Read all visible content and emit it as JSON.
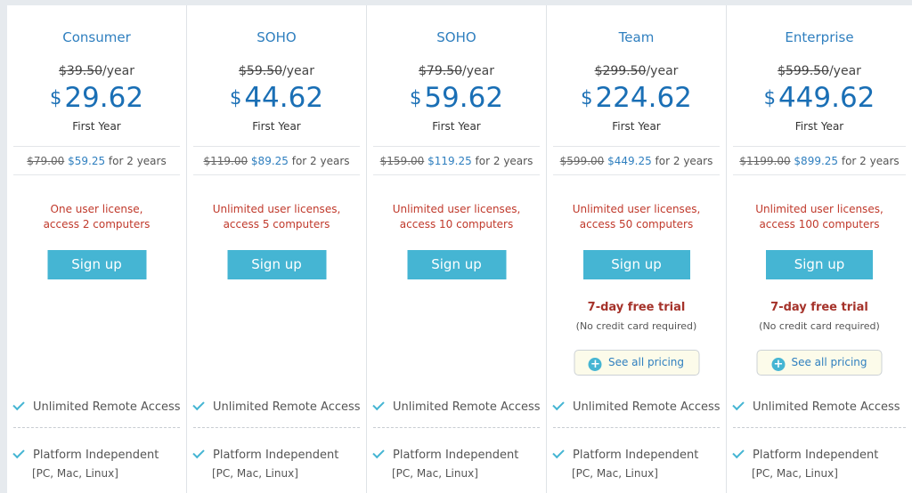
{
  "plans": [
    {
      "name": "Consumer",
      "old_price": "$39.50",
      "per_year": "/year",
      "currency": "$",
      "price": "29.62",
      "first_year": "First Year",
      "two_year_old": "$79.00",
      "two_year_new": "$59.25",
      "two_year_suffix": " for 2 years",
      "license_line1": "One user license,",
      "license_line2": "access 2 computers",
      "signup": "Sign up",
      "feature1": "Unlimited Remote Access",
      "feature2": "Platform Independent",
      "feature2_sub": "[PC, Mac, Linux]"
    },
    {
      "name": "SOHO",
      "old_price": "$59.50",
      "per_year": "/year",
      "currency": "$",
      "price": "44.62",
      "first_year": "First Year",
      "two_year_old": "$119.00",
      "two_year_new": "$89.25",
      "two_year_suffix": " for 2 years",
      "license_line1": "Unlimited user licenses,",
      "license_line2": "access 5 computers",
      "signup": "Sign up",
      "feature1": "Unlimited Remote Access",
      "feature2": "Platform Independent",
      "feature2_sub": "[PC, Mac, Linux]"
    },
    {
      "name": "SOHO",
      "old_price": "$79.50",
      "per_year": "/year",
      "currency": "$",
      "price": "59.62",
      "first_year": "First Year",
      "two_year_old": "$159.00",
      "two_year_new": "$119.25",
      "two_year_suffix": " for 2 years",
      "license_line1": "Unlimited user licenses,",
      "license_line2": "access 10 computers",
      "signup": "Sign up",
      "feature1": "Unlimited Remote Access",
      "feature2": "Platform Independent",
      "feature2_sub": "[PC, Mac, Linux]"
    },
    {
      "name": "Team",
      "old_price": "$299.50",
      "per_year": "/year",
      "currency": "$",
      "price": "224.62",
      "first_year": "First Year",
      "two_year_old": "$599.00",
      "two_year_new": "$449.25",
      "two_year_suffix": " for 2 years",
      "license_line1": "Unlimited user licenses,",
      "license_line2": "access 50 computers",
      "signup": "Sign up",
      "trial": "7-day free trial",
      "trial_note": "(No credit card required)",
      "see_all": "See all pricing",
      "feature1": "Unlimited Remote Access",
      "feature2": "Platform Independent",
      "feature2_sub": "[PC, Mac, Linux]"
    },
    {
      "name": "Enterprise",
      "old_price": "$599.50",
      "per_year": "/year",
      "currency": "$",
      "price": "449.62",
      "first_year": "First Year",
      "two_year_old": "$1199.00",
      "two_year_new": "$899.25",
      "two_year_suffix": " for 2 years",
      "license_line1": "Unlimited user licenses,",
      "license_line2": "access 100 computers",
      "signup": "Sign up",
      "trial": "7-day free trial",
      "trial_note": "(No credit card required)",
      "see_all": "See all pricing",
      "feature1": "Unlimited Remote Access",
      "feature2": "Platform Independent",
      "feature2_sub": "[PC, Mac, Linux]"
    }
  ],
  "colors": {
    "accent_blue": "#2f7fbf",
    "button": "#45b5d3",
    "license_red": "#c0392b",
    "trial_red": "#a5322a"
  },
  "icons": {
    "check": "check-icon",
    "plus": "plus-circle-icon"
  }
}
